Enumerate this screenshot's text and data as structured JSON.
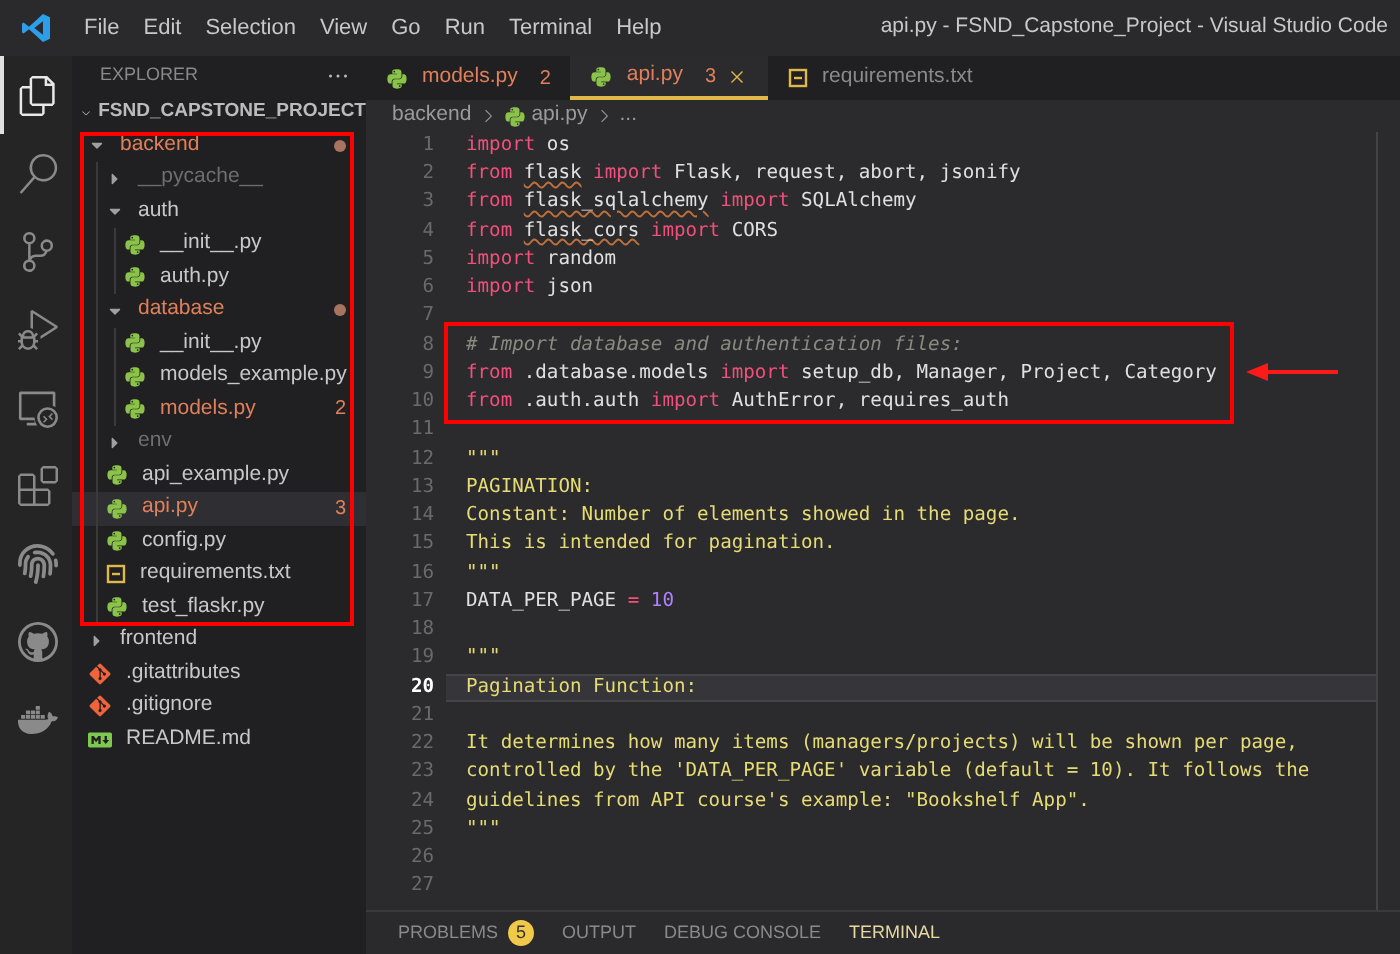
{
  "window": {
    "title": "api.py - FSND_Capstone_Project - Visual Studio Code"
  },
  "menu": [
    "File",
    "Edit",
    "Selection",
    "View",
    "Go",
    "Run",
    "Terminal",
    "Help"
  ],
  "activity_bar": [
    {
      "kind": "files",
      "selected": true
    },
    {
      "kind": "search",
      "selected": false
    },
    {
      "kind": "source_control",
      "selected": false
    },
    {
      "kind": "debug",
      "selected": false
    },
    {
      "kind": "remote",
      "selected": false
    },
    {
      "kind": "extensions",
      "selected": false
    },
    {
      "kind": "fingerprint",
      "selected": false
    },
    {
      "kind": "github",
      "selected": false
    },
    {
      "kind": "docker",
      "selected": false
    }
  ],
  "explorer": {
    "title": "EXPLORER",
    "project": {
      "label": "FSND_CAPSTONE_PROJECT",
      "expanded": true
    },
    "tree": [
      {
        "label": "backend",
        "kind": "folder",
        "expanded": true,
        "modified": true,
        "ignored": false,
        "selected": false,
        "children": [
          {
            "label": "__pycache__",
            "kind": "folder",
            "expanded": false,
            "modified": false,
            "ignored": true,
            "selected": false
          },
          {
            "label": "auth",
            "kind": "folder",
            "expanded": true,
            "modified": false,
            "ignored": false,
            "selected": false,
            "children": [
              {
                "label": "__init__.py",
                "kind": "python",
                "modified": false,
                "ignored": false,
                "selected": false
              },
              {
                "label": "auth.py",
                "kind": "python",
                "modified": false,
                "ignored": false,
                "selected": false
              }
            ]
          },
          {
            "label": "database",
            "kind": "folder",
            "expanded": true,
            "modified": true,
            "ignored": false,
            "selected": false,
            "children": [
              {
                "label": "__init__.py",
                "kind": "python",
                "modified": false,
                "ignored": false,
                "selected": false
              },
              {
                "label": "models_example.py",
                "kind": "python",
                "modified": false,
                "ignored": false,
                "selected": false
              },
              {
                "label": "models.py",
                "kind": "python",
                "modified": true,
                "ignored": false,
                "badge": "2",
                "selected": false
              }
            ]
          },
          {
            "label": "env",
            "kind": "folder",
            "expanded": false,
            "modified": false,
            "ignored": true,
            "selected": false
          },
          {
            "label": "api_example.py",
            "kind": "python",
            "modified": false,
            "ignored": false,
            "selected": false
          },
          {
            "label": "api.py",
            "kind": "python",
            "modified": true,
            "ignored": false,
            "badge": "3",
            "selected": true
          },
          {
            "label": "config.py",
            "kind": "python",
            "modified": false,
            "ignored": false,
            "selected": false
          },
          {
            "label": "requirements.txt",
            "kind": "text",
            "modified": false,
            "ignored": false,
            "selected": false
          },
          {
            "label": "test_flaskr.py",
            "kind": "python",
            "modified": false,
            "ignored": false,
            "selected": false
          }
        ]
      },
      {
        "label": "frontend",
        "kind": "folder",
        "expanded": false,
        "modified": false,
        "ignored": false,
        "selected": false
      },
      {
        "label": ".gitattributes",
        "kind": "git",
        "modified": false,
        "ignored": false,
        "selected": false
      },
      {
        "label": ".gitignore",
        "kind": "git",
        "modified": false,
        "ignored": false,
        "selected": false
      },
      {
        "label": "README.md",
        "kind": "markdown",
        "modified": false,
        "ignored": false,
        "selected": false
      }
    ]
  },
  "tabs": [
    {
      "label": "models.py",
      "kind": "python",
      "modified": true,
      "badge": "2",
      "selected": false
    },
    {
      "label": "api.py",
      "kind": "python",
      "modified": true,
      "badge": "3",
      "selected": true
    },
    {
      "label": "requirements.txt",
      "kind": "text",
      "modified": false,
      "selected": false
    }
  ],
  "breadcrumb": [
    {
      "label": "backend",
      "kind": "folder"
    },
    {
      "label": "api.py",
      "kind": "python"
    },
    {
      "label": "...",
      "kind": "more"
    }
  ],
  "editor": {
    "lines": [
      {
        "number": "1",
        "current": false,
        "tokens": [
          {
            "text": "import",
            "kind": "keyword"
          },
          {
            "text": " os",
            "kind": "plain"
          }
        ]
      },
      {
        "number": "2",
        "current": false,
        "tokens": [
          {
            "text": "from ",
            "kind": "keyword"
          },
          {
            "text": "flask",
            "kind": "module"
          },
          {
            "text": " import",
            "kind": "keyword"
          },
          {
            "text": " Flask, request, abort, jsonify",
            "kind": "plain"
          }
        ]
      },
      {
        "number": "3",
        "current": false,
        "tokens": [
          {
            "text": "from ",
            "kind": "keyword"
          },
          {
            "text": "flask_sqlalchemy",
            "kind": "module"
          },
          {
            "text": " import",
            "kind": "keyword"
          },
          {
            "text": " SQLAlchemy",
            "kind": "plain"
          }
        ]
      },
      {
        "number": "4",
        "current": false,
        "tokens": [
          {
            "text": "from ",
            "kind": "keyword"
          },
          {
            "text": "flask_cors",
            "kind": "module"
          },
          {
            "text": " import",
            "kind": "keyword"
          },
          {
            "text": " CORS",
            "kind": "plain"
          }
        ]
      },
      {
        "number": "5",
        "current": false,
        "tokens": [
          {
            "text": "import",
            "kind": "keyword"
          },
          {
            "text": " random",
            "kind": "plain"
          }
        ]
      },
      {
        "number": "6",
        "current": false,
        "tokens": [
          {
            "text": "import",
            "kind": "keyword"
          },
          {
            "text": " json",
            "kind": "plain"
          }
        ]
      },
      {
        "number": "7",
        "current": false
      },
      {
        "number": "8",
        "current": false,
        "tokens": [
          {
            "text": "# Import database and authentication files:",
            "kind": "comment"
          }
        ]
      },
      {
        "number": "9",
        "current": false,
        "tokens": [
          {
            "text": "from",
            "kind": "keyword"
          },
          {
            "text": " .database.models ",
            "kind": "plain"
          },
          {
            "text": "import",
            "kind": "keyword"
          },
          {
            "text": " setup_db, Manager, Project, Category",
            "kind": "plain"
          }
        ]
      },
      {
        "number": "10",
        "current": false,
        "tokens": [
          {
            "text": "from",
            "kind": "keyword"
          },
          {
            "text": " .auth.auth ",
            "kind": "plain"
          },
          {
            "text": "import",
            "kind": "keyword"
          },
          {
            "text": " AuthError, requires_auth",
            "kind": "plain"
          }
        ]
      },
      {
        "number": "11",
        "current": false
      },
      {
        "number": "12",
        "current": false,
        "tokens": [
          {
            "text": "\"\"\"",
            "kind": "string"
          }
        ]
      },
      {
        "number": "13",
        "current": false,
        "tokens": [
          {
            "text": "PAGINATION:",
            "kind": "string"
          }
        ]
      },
      {
        "number": "14",
        "current": false,
        "tokens": [
          {
            "text": "Constant: Number of elements showed in the page.",
            "kind": "string"
          }
        ]
      },
      {
        "number": "15",
        "current": false,
        "tokens": [
          {
            "text": "This is intended for pagination.",
            "kind": "string"
          }
        ]
      },
      {
        "number": "16",
        "current": false,
        "tokens": [
          {
            "text": "\"\"\"",
            "kind": "string"
          }
        ]
      },
      {
        "number": "17",
        "current": false,
        "tokens": [
          {
            "text": "DATA_PER_PAGE",
            "kind": "plain"
          },
          {
            "text": " = ",
            "kind": "operator"
          },
          {
            "text": "10",
            "kind": "number"
          }
        ]
      },
      {
        "number": "18",
        "current": false
      },
      {
        "number": "19",
        "current": false,
        "tokens": [
          {
            "text": "\"\"\"",
            "kind": "string"
          }
        ]
      },
      {
        "number": "20",
        "current": true,
        "tokens": [
          {
            "text": "Pagination Function:",
            "kind": "string"
          }
        ]
      },
      {
        "number": "21",
        "current": false
      },
      {
        "number": "22",
        "current": false,
        "tokens": [
          {
            "text": "It determines how many items (managers/projects) will be shown per page,",
            "kind": "string"
          }
        ]
      },
      {
        "number": "23",
        "current": false,
        "tokens": [
          {
            "text": "controlled by the 'DATA_PER_PAGE' variable (default = 10). It follows the",
            "kind": "string"
          }
        ]
      },
      {
        "number": "24",
        "current": false,
        "tokens": [
          {
            "text": "guidelines from API course's example: \"Bookshelf App\".",
            "kind": "string"
          }
        ]
      },
      {
        "number": "25",
        "current": false,
        "tokens": [
          {
            "text": "\"\"\"",
            "kind": "string"
          }
        ]
      },
      {
        "number": "26",
        "current": false
      },
      {
        "number": "27",
        "current": false
      }
    ]
  },
  "panel": {
    "tabs": [
      {
        "label": "PROBLEMS",
        "badge": "5",
        "selected": false
      },
      {
        "label": "OUTPUT",
        "selected": false
      },
      {
        "label": "DEBUG CONSOLE",
        "selected": false
      },
      {
        "label": "TERMINAL",
        "selected": true
      }
    ]
  }
}
